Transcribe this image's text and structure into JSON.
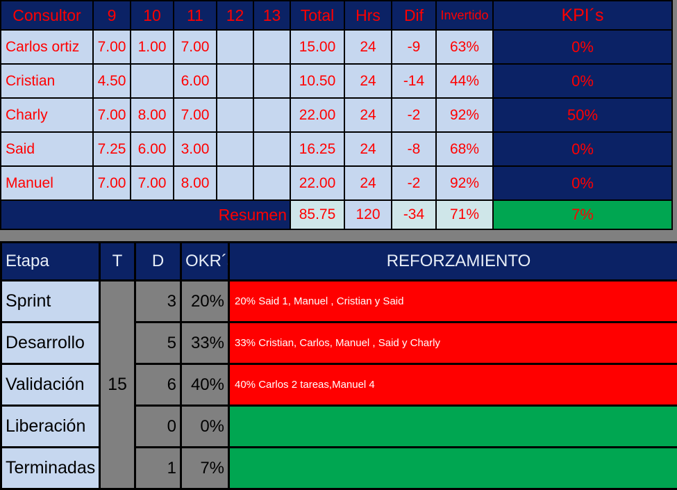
{
  "top_table": {
    "headers": [
      "Consultor",
      "9",
      "10",
      "11",
      "12",
      "13",
      "Total",
      "Hrs",
      "Dif",
      "Invertido"
    ],
    "kpi_header": "KPI´s",
    "rows": [
      {
        "consultor": "Carlos ortiz",
        "d9": "7.00",
        "d10": "1.00",
        "d11": "7.00",
        "d12": "",
        "d13": "",
        "total": "15.00",
        "hrs": "24",
        "dif": "-9",
        "invertido": "63%",
        "kpi": "0%"
      },
      {
        "consultor": "Cristian",
        "d9": "4.50",
        "d10": "",
        "d11": "6.00",
        "d12": "",
        "d13": "",
        "total": "10.50",
        "hrs": "24",
        "dif": "-14",
        "invertido": "44%",
        "kpi": "0%"
      },
      {
        "consultor": "Charly",
        "d9": "7.00",
        "d10": "8.00",
        "d11": "7.00",
        "d12": "",
        "d13": "",
        "total": "22.00",
        "hrs": "24",
        "dif": "-2",
        "invertido": "92%",
        "kpi": "50%"
      },
      {
        "consultor": "Said",
        "d9": "7.25",
        "d10": "6.00",
        "d11": "3.00",
        "d12": "",
        "d13": "",
        "total": "16.25",
        "hrs": "24",
        "dif": "-8",
        "invertido": "68%",
        "kpi": "0%"
      },
      {
        "consultor": "Manuel",
        "d9": "7.00",
        "d10": "7.00",
        "d11": "8.00",
        "d12": "",
        "d13": "",
        "total": "22.00",
        "hrs": "24",
        "dif": "-2",
        "invertido": "92%",
        "kpi": "0%"
      }
    ],
    "summary": {
      "label": "Resumen",
      "total": "85.75",
      "hrs": "120",
      "dif": "-34",
      "invertido": "71%",
      "kpi": "7%"
    }
  },
  "bottom_table": {
    "headers": [
      "Etapa",
      "T",
      "D",
      "OKR´s",
      "REFORZAMIENTO"
    ],
    "t_value": "15",
    "rows": [
      {
        "etapa": "Sprint",
        "d": "3",
        "okr": "20%",
        "reforzamiento": "20% Said 1,  Manuel , Cristian y Said",
        "status": "red"
      },
      {
        "etapa": "Desarrollo",
        "d": "5",
        "okr": "33%",
        "reforzamiento": "33% Cristian, Carlos, Manuel , Said y Charly",
        "status": "red"
      },
      {
        "etapa": "Validación",
        "d": "6",
        "okr": "40%",
        "reforzamiento": "40%  Carlos 2 tareas,Manuel 4",
        "status": "red"
      },
      {
        "etapa": "Liberación",
        "d": "0",
        "okr": "0%",
        "reforzamiento": "",
        "status": "green"
      },
      {
        "etapa": "Terminadas",
        "d": "1",
        "okr": "7%",
        "reforzamiento": "",
        "status": "green"
      }
    ]
  },
  "colors": {
    "header_navy": "#0B2265",
    "cell_blue": "#C6D7EF",
    "text_red": "#FF0000",
    "green": "#00A651",
    "red": "#FF0000",
    "gray": "#808080"
  }
}
